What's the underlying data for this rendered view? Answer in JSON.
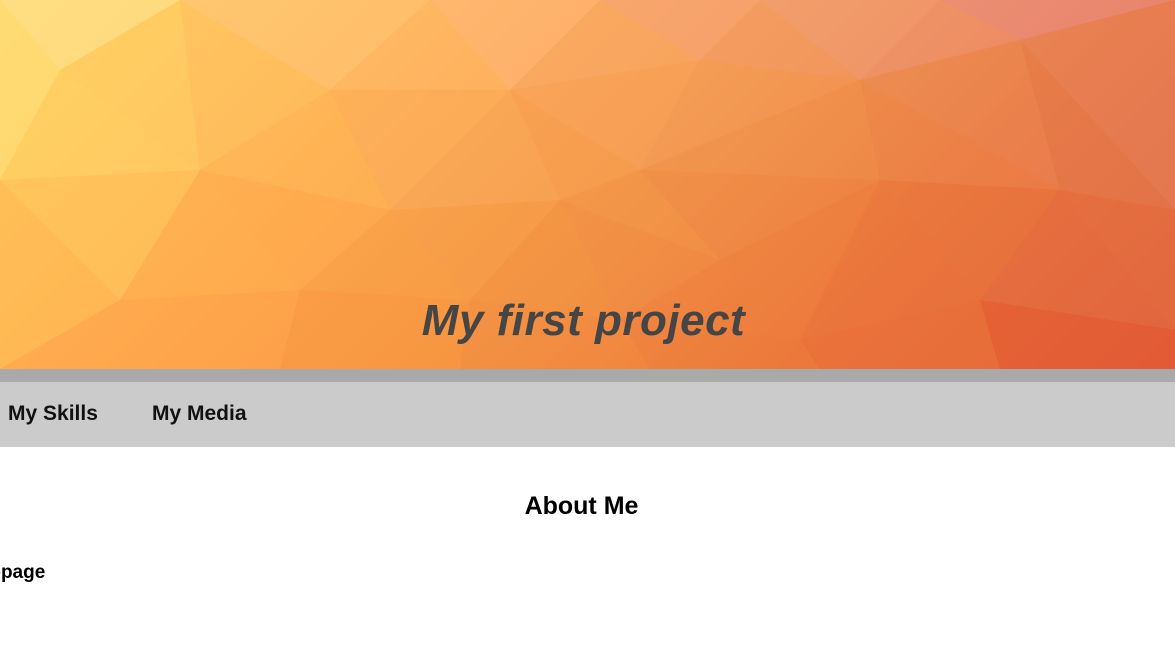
{
  "header": {
    "title": "My first project"
  },
  "nav": {
    "items": [
      {
        "label": "My Skills"
      },
      {
        "label": "My Media"
      }
    ]
  },
  "main": {
    "heading": "About Me",
    "intro_fragment": "webpage"
  },
  "colors": {
    "hero_gradient": [
      "#ffd66a",
      "#ffb257",
      "#f59a4a",
      "#ef7a3c",
      "#e3633a"
    ],
    "title_text": "#454545",
    "nav_strip": "#a9a9a9",
    "nav_background": "#cbcbcb"
  }
}
